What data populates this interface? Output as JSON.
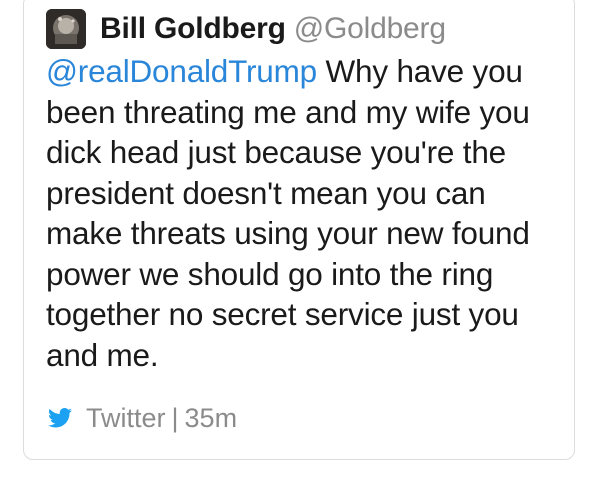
{
  "tweet": {
    "author": {
      "display_name": "Bill Goldberg",
      "handle": "@Goldberg",
      "avatar_icon": "profile-photo"
    },
    "mention": "@realDonaldTrump",
    "body": "Why have you been threating me and my wife you dick head just because you're the president doesn't mean you can make threats using your new found power we should go into the ring together no secret service just you and me.",
    "source": "Twitter",
    "separator": "|",
    "time": "35m",
    "source_icon": "twitter-bird-icon"
  },
  "colors": {
    "mention": "#2a86d9",
    "muted": "#8b8b8b",
    "text": "#1a1a1a",
    "twitter_blue": "#1da1f2"
  }
}
